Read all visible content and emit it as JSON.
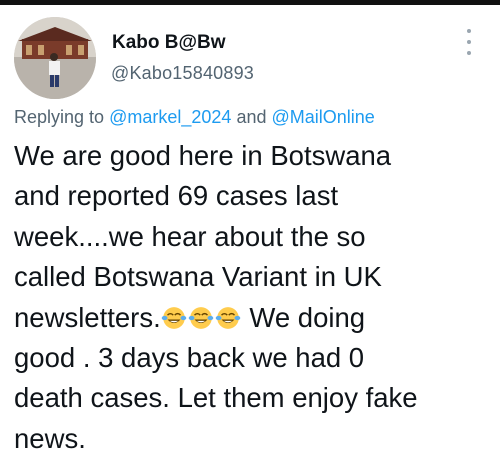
{
  "tweet": {
    "author": {
      "display_name": "Kabo B@Bw",
      "handle": "@Kabo15840893"
    },
    "more_icon": "three-dots-vertical-icon",
    "replying_prefix": "Replying to",
    "replying_to": [
      "@markel_2024",
      "@MailOnline"
    ],
    "replying_join": "and",
    "body_part1": "We are good here in Botswana\nand reported 69 cases last\nweek....we hear about the so\ncalled Botswana Variant in UK\nnewsletters.",
    "emoji": [
      "face-with-tears-of-joy",
      "face-with-tears-of-joy",
      "face-with-tears-of-joy"
    ],
    "body_part2": " We doing\ngood . 3 days back we had 0\ndeath cases. Let them enjoy fake\nnews."
  },
  "colors": {
    "text": "#0f1419",
    "secondary": "#536471",
    "link": "#1d9bf0"
  }
}
